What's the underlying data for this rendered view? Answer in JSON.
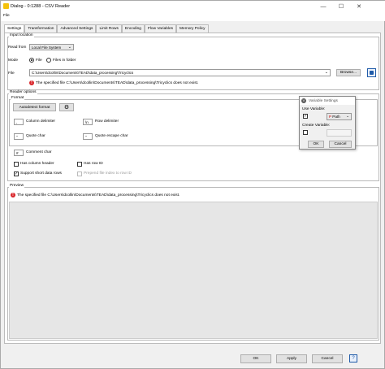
{
  "window": {
    "title": "Dialog - 0:1288 - CSV Reader"
  },
  "menubar": {
    "file": "File"
  },
  "tabs": [
    "Settings",
    "Transformation",
    "Advanced Settings",
    "Limit Rows",
    "Encoding",
    "Flow Variables",
    "Memory Policy"
  ],
  "input_location": {
    "title": "Input location",
    "read_from_label": "Read from",
    "read_from_value": "Local File System",
    "mode_label": "Mode",
    "mode_file": "File",
    "mode_files_in_folder": "Files in folder",
    "file_label": "File",
    "file_value": "C:\\Users\\dcollin\\Documents\\TEAD\\data_processing\\Tricyclics",
    "browse": "Browse...",
    "error": "The specified file C:\\Users\\dcollin\\Documents\\TEAD\\data_processing\\Tricyclics does not exist."
  },
  "reader_options": {
    "title": "Reader options",
    "format_title": "Format",
    "autodetect": "Autodetect format",
    "column_delimiter_value": ",",
    "column_delimiter_label": "Column delimiter",
    "row_delimiter_value": "\\n",
    "row_delimiter_label": "Row delimiter",
    "quote_char_value": "\"",
    "quote_char_label": "Quote char",
    "quote_escape_value": "\"",
    "quote_escape_label": "Quote escape char",
    "comment_char_value": "#",
    "comment_char_label": "Comment char",
    "has_column_header": "Has column header",
    "has_row_id": "Has row ID",
    "support_short_rows": "Support short data rows",
    "prepend_file_index": "Prepend file index to row ID"
  },
  "preview": {
    "title": "Preview",
    "error": "The specified file C:\\Users\\dcollin\\Documents\\TEAD\\data_processing\\Tricyclics does not exist."
  },
  "variable_popup": {
    "title": "Variable Settings",
    "use_variable": "Use Variable:",
    "variable_value": "Path",
    "create_variable": "Create Variable:",
    "ok": "OK",
    "cancel": "Cancel"
  },
  "footer": {
    "ok": "OK",
    "apply": "Apply",
    "cancel": "Cancel",
    "help": "?"
  },
  "colors": {
    "error": "#d9262b",
    "accent_blue": "#1e5aa8",
    "variable_icon": "#5b5b5b"
  }
}
